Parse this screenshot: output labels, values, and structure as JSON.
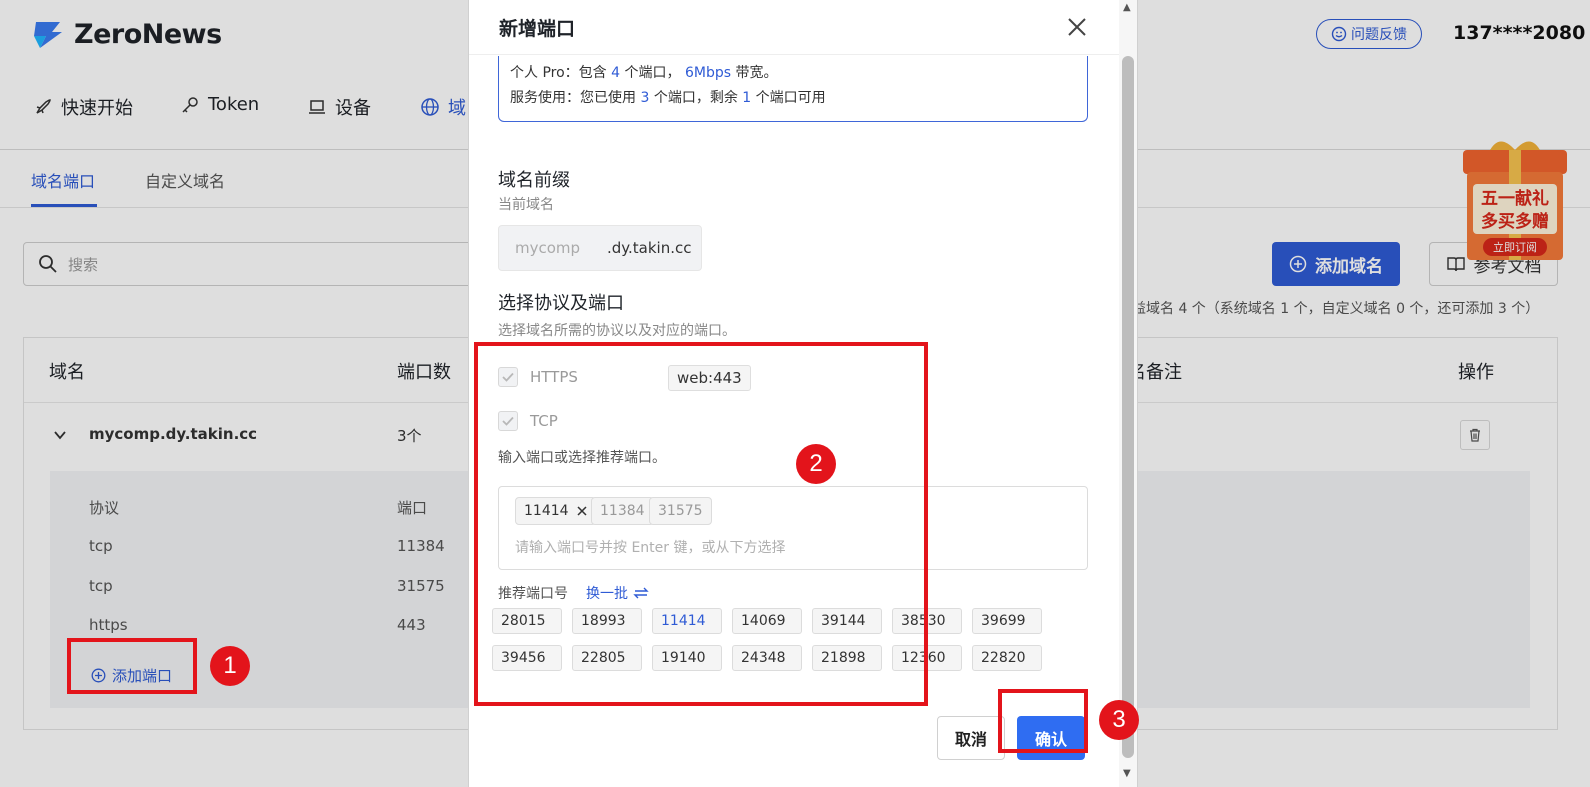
{
  "app": {
    "brand": "ZeroNews",
    "feedback": "问题反馈",
    "phone": "137****2080"
  },
  "topnav": [
    "快速开始",
    "Token",
    "设备",
    "域"
  ],
  "subtabs": {
    "active": "域名端口",
    "other": "自定义域名"
  },
  "search": {
    "placeholder": "搜索"
  },
  "actions": {
    "add_domain": "添加域名",
    "docs": "参考文档"
  },
  "quota_text": "益域名 4 个（系统域名 1 个，自定义域名 0 个，还可添加 3 个）",
  "table": {
    "headers": {
      "domain": "域名",
      "ports": "端口数",
      "remark": "名备注",
      "ops": "操作"
    },
    "row": {
      "domain": "mycomp.dy.takin.cc",
      "ports": "3个"
    },
    "sub_headers": {
      "protocol": "协议",
      "port": "端口"
    },
    "sub_rows": [
      {
        "protocol": "tcp",
        "port": "11384"
      },
      {
        "protocol": "tcp",
        "port": "31575"
      },
      {
        "protocol": "https",
        "port": "443"
      }
    ],
    "add_port": "添加端口"
  },
  "promo": {
    "line1": "五一献礼",
    "line2": "多买多赠",
    "cta": "立即订阅"
  },
  "modal": {
    "title": "新增端口",
    "plan_line1": {
      "a": "个人 Pro：包含 ",
      "n": "4",
      "b": " 个端口， ",
      "bw": "6Mbps",
      "c": " 带宽。"
    },
    "plan_line2": {
      "a": "服务使用：您已使用 ",
      "used": "3",
      "b": " 个端口，剩余 ",
      "left": "1",
      "c": " 个端口可用"
    },
    "prefix_title": "域名前缀",
    "prefix_sub": "当前域名",
    "prefix_placeholder": "mycomp",
    "prefix_suffix": ".dy.takin.cc",
    "proto_title": "选择协议及端口",
    "proto_sub": "选择域名所需的协议以及对应的端口。",
    "https_label": "HTTPS",
    "https_port": "web:443",
    "tcp_label": "TCP",
    "hint": "输入端口或选择推荐端口。",
    "chips": [
      "11414",
      "11384",
      "31575"
    ],
    "input_placeholder": "请输入端口号并按 Enter 键，或从下方选择",
    "rec_label": "推荐端口号",
    "rec_refresh": "换一批",
    "rec_row1": [
      "28015",
      "18993",
      "11414",
      "14069",
      "39144",
      "38530",
      "39699"
    ],
    "rec_row2": [
      "39456",
      "22805",
      "19140",
      "24348",
      "21898",
      "12360",
      "22820"
    ],
    "cancel": "取消",
    "confirm": "确认"
  },
  "annotations": [
    "1",
    "2",
    "3"
  ],
  "colors": {
    "accent": "#2f5bd5",
    "confirm": "#2f6df2",
    "annotation": "#e3141b"
  }
}
